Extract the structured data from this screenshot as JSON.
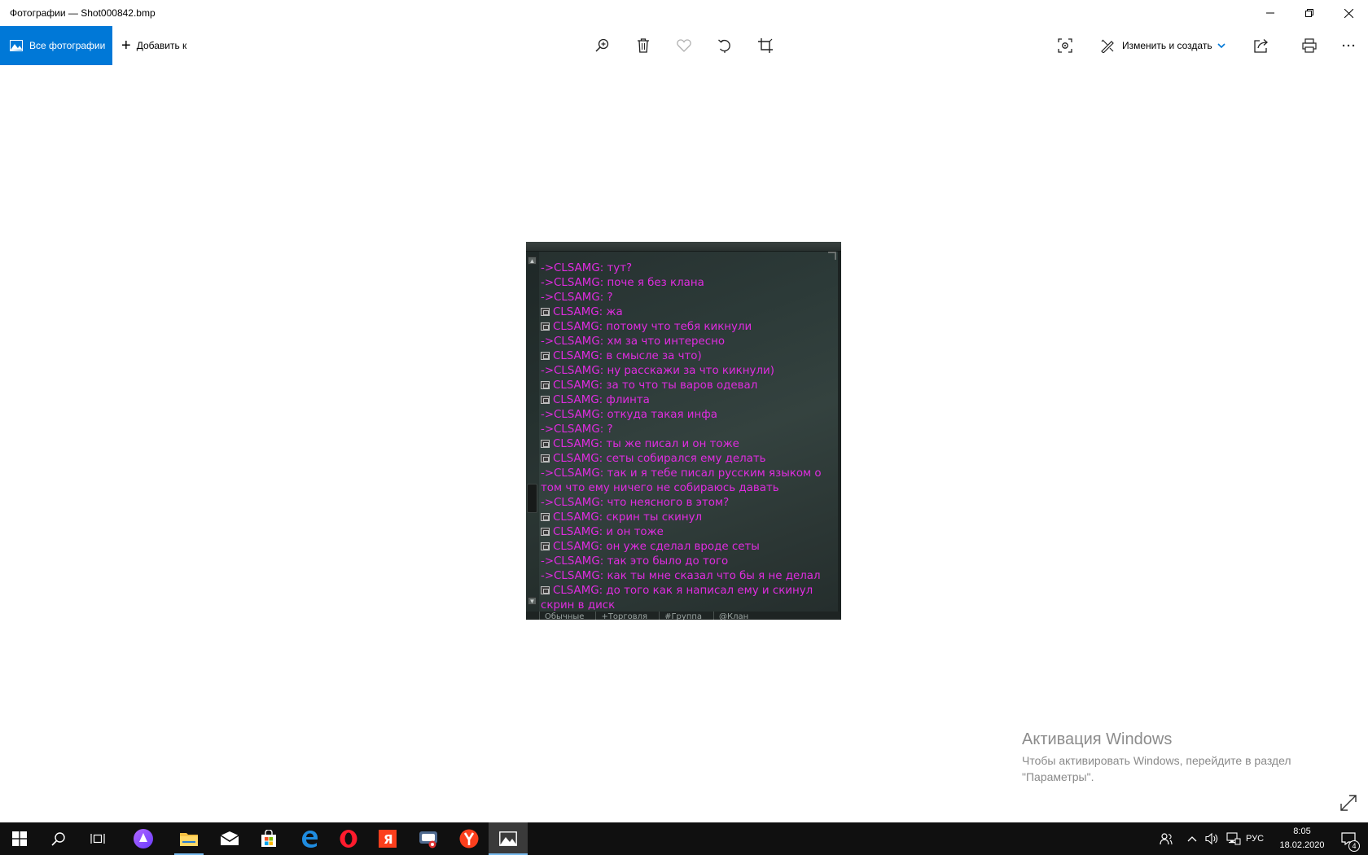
{
  "window": {
    "title": "Фотографии — Shot000842.bmp"
  },
  "toolbar": {
    "all_photos_label": "Все фотографии",
    "add_to_label": "Добавить к",
    "edit_create_label": "Изменить и создать",
    "icons": [
      "zoom-in-icon",
      "delete-icon",
      "favorite-heart-icon",
      "rotate-icon",
      "crop-icon",
      "enhance-icon",
      "edit-create-icon",
      "share-icon",
      "print-icon",
      "more-icon"
    ]
  },
  "image": {
    "chat_lines": [
      {
        "kind": "out",
        "text": "->CLSAMG: тут?"
      },
      {
        "kind": "out",
        "text": "->CLSAMG: поче я без клана"
      },
      {
        "kind": "out",
        "text": "->CLSAMG: ?"
      },
      {
        "kind": "in",
        "text": "CLSAMG: жа"
      },
      {
        "kind": "in",
        "text": "CLSAMG: потому что тебя кикнули"
      },
      {
        "kind": "out",
        "text": "->CLSAMG: хм за что интересно"
      },
      {
        "kind": "in",
        "text": "CLSAMG: в смысле за что)"
      },
      {
        "kind": "out",
        "text": "->CLSAMG: ну расскажи за что кикнули)"
      },
      {
        "kind": "in",
        "text": "CLSAMG: за то что ты варов одевал"
      },
      {
        "kind": "in",
        "text": "CLSAMG: флинта"
      },
      {
        "kind": "out",
        "text": "->CLSAMG: откуда такая инфа"
      },
      {
        "kind": "out",
        "text": "->CLSAMG: ?"
      },
      {
        "kind": "in",
        "text": "CLSAMG: ты же писал и он тоже"
      },
      {
        "kind": "in",
        "text": "CLSAMG: сеты собирался ему делать"
      },
      {
        "kind": "out",
        "text": "->CLSAMG: так и я тебе писал русским языком о"
      },
      {
        "kind": "cont",
        "text": "том что ему ничего не собираюсь давать"
      },
      {
        "kind": "out",
        "text": "->CLSAMG: что неясного в этом?"
      },
      {
        "kind": "in",
        "text": "CLSAMG: скрин ты скинул"
      },
      {
        "kind": "in",
        "text": "CLSAMG: и он тоже"
      },
      {
        "kind": "in",
        "text": "CLSAMG: он уже сделал вроде сеты"
      },
      {
        "kind": "out",
        "text": "->CLSAMG: так это было до того"
      },
      {
        "kind": "out",
        "text": "->CLSAMG: как ты мне сказал что бы я не делал"
      },
      {
        "kind": "in",
        "text": "CLSAMG: до того как я написал ему и скинул"
      },
      {
        "kind": "cont",
        "text": "скрин в диск"
      }
    ],
    "tabs": [
      "Обычные",
      "+Торговля",
      "#Группа",
      "@Клан"
    ],
    "text_color": "#e02ce0"
  },
  "watermark": {
    "heading": "Активация Windows",
    "line1": "Чтобы активировать Windows, перейдите в раздел",
    "line2": "\"Параметры\"."
  },
  "taskbar": {
    "apps": [
      "windows-start-icon",
      "search-icon",
      "task-view-icon",
      "alice-icon",
      "file-explorer-icon",
      "mail-icon",
      "store-icon",
      "edge-icon",
      "opera-icon",
      "yandex-ya-icon",
      "chat-app-icon",
      "yandex-browser-icon",
      "photos-icon"
    ],
    "language": "РУС",
    "time": "8:05",
    "date": "18.02.2020",
    "notification_count": "4"
  }
}
